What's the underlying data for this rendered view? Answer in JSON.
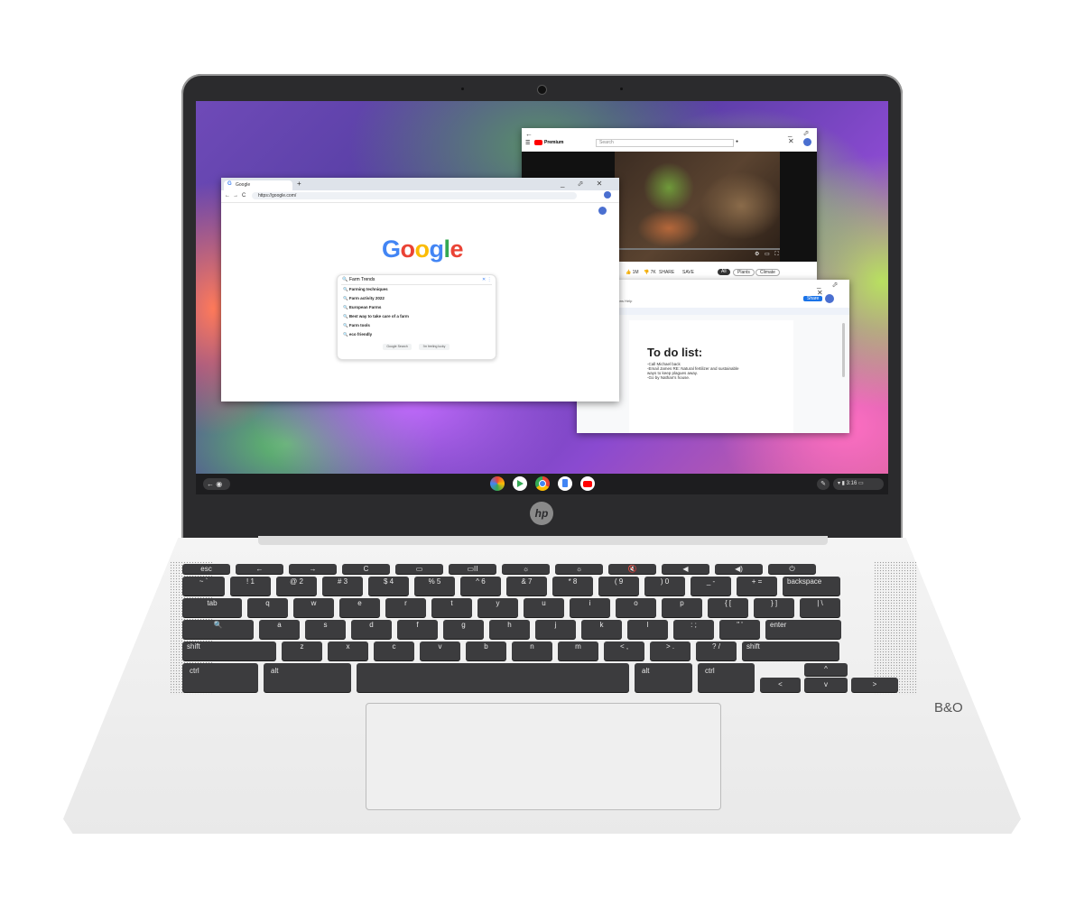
{
  "chrome": {
    "tab_title": "Google",
    "new_tab": "+",
    "url": "https://google.com/",
    "window_controls": [
      "_",
      "⬀",
      "✕"
    ],
    "nav": [
      "←",
      "→",
      "C"
    ],
    "logo_letters": [
      "G",
      "o",
      "o",
      "g",
      "l",
      "e"
    ],
    "logo_colors": [
      "#4285F4",
      "#EA4335",
      "#FBBC05",
      "#4285F4",
      "#34A853",
      "#EA4335"
    ],
    "search_value": "Farm Trends",
    "suggestions": [
      "Farming techniques",
      "Farm activity 2022",
      "European Farms",
      "Best way to take care of a farm",
      "Farm tools",
      "eco friendly"
    ],
    "search_button": "Google Search",
    "lucky_button": "I'm feeling lucky"
  },
  "youtube": {
    "brand": "Premium",
    "search_placeholder": "Search",
    "chips": [
      "All",
      "Plants",
      "Climate"
    ],
    "like_count": "1M",
    "dislike_count": "7K",
    "share": "SHARE",
    "save": "SAVE"
  },
  "docs": {
    "menu": "Insert  Format  Tools  Add-ons  Help",
    "share": "Share",
    "heading": "To do list:",
    "lines": [
      "-Call Michael back",
      "-Email James RE: Natural fertilizer and sustainable",
      "ways to keep plagues away.",
      "-Go by Nathan's house."
    ]
  },
  "shelf": {
    "launcher_icons": [
      "back-icon",
      "launcher-icon"
    ],
    "apps": [
      "photos",
      "play-store",
      "chrome",
      "docs",
      "youtube"
    ],
    "app_colors": [
      "#ffffff",
      "#ffffff",
      "#ffffff",
      "#4285F4",
      "#ffffff"
    ],
    "time": "3:16"
  },
  "keyboard": {
    "row0": [
      "esc",
      "←",
      "→",
      "C",
      "▭",
      "▭II",
      "☼",
      "☼",
      "🔇",
      "◀",
      "◀)",
      "⏻"
    ],
    "row1": [
      "~ `",
      "! 1",
      "@ 2",
      "# 3",
      "$ 4",
      "% 5",
      "^ 6",
      "& 7",
      "* 8",
      "( 9",
      ") 0",
      "_ -",
      "+ =",
      "backspace"
    ],
    "row2": [
      "tab",
      "q",
      "w",
      "e",
      "r",
      "t",
      "y",
      "u",
      "i",
      "o",
      "p",
      "{ [",
      "} ]",
      "| \\"
    ],
    "row3": [
      "🔍",
      "a",
      "s",
      "d",
      "f",
      "g",
      "h",
      "j",
      "k",
      "l",
      ": ;",
      "\" '",
      "enter"
    ],
    "row4": [
      "shift",
      "z",
      "x",
      "c",
      "v",
      "b",
      "n",
      "m",
      "< ,",
      "> .",
      "? /",
      "shift"
    ],
    "row5": [
      "ctrl",
      "alt",
      "",
      "alt",
      "ctrl"
    ],
    "arrows": [
      "^",
      "<",
      "v",
      ">"
    ]
  },
  "branding": {
    "hp": "hp",
    "bo": "B&O"
  }
}
